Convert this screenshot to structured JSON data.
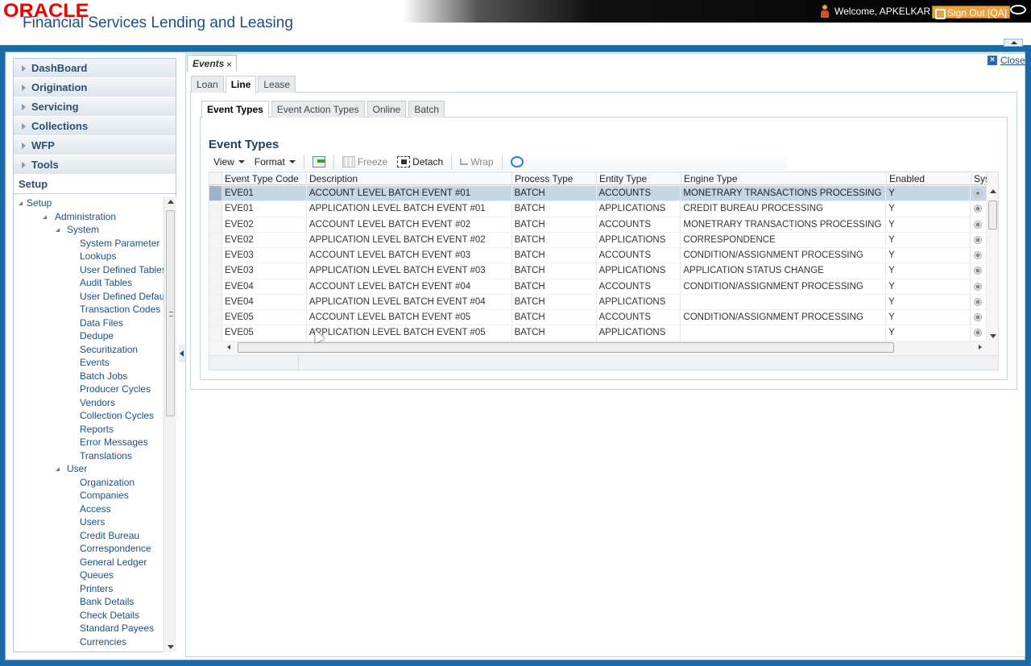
{
  "header": {
    "logo": "ORACLE",
    "product": "Financial Services Lending and Leasing",
    "welcome": "Welcome, APKELKAR",
    "sign_out": "Sign Out [QA]"
  },
  "nav": {
    "sections": [
      "DashBoard",
      "Origination",
      "Servicing",
      "Collections",
      "WFP",
      "Tools"
    ],
    "setup_label": "Setup",
    "tree": [
      {
        "label": "Setup",
        "level": 0,
        "expanded": true
      },
      {
        "label": "Administration",
        "level": 1,
        "expanded": true
      },
      {
        "label": "System",
        "level": 2,
        "expanded": true
      },
      {
        "label": "System Parameter",
        "level": 3
      },
      {
        "label": "Lookups",
        "level": 3
      },
      {
        "label": "User Defined Tables",
        "level": 3
      },
      {
        "label": "Audit Tables",
        "level": 3
      },
      {
        "label": "User Defined Defaults",
        "level": 3
      },
      {
        "label": "Transaction Codes",
        "level": 3
      },
      {
        "label": "Data Files",
        "level": 3
      },
      {
        "label": "Dedupe",
        "level": 3
      },
      {
        "label": "Securitization",
        "level": 3
      },
      {
        "label": "Events",
        "level": 3
      },
      {
        "label": "Batch Jobs",
        "level": 3
      },
      {
        "label": "Producer Cycles",
        "level": 3
      },
      {
        "label": "Vendors",
        "level": 3
      },
      {
        "label": "Collection Cycles",
        "level": 3
      },
      {
        "label": "Reports",
        "level": 3
      },
      {
        "label": "Error Messages",
        "level": 3
      },
      {
        "label": "Translations",
        "level": 3
      },
      {
        "label": "User",
        "level": 2,
        "expanded": true
      },
      {
        "label": "Organization",
        "level": 3
      },
      {
        "label": "Companies",
        "level": 3
      },
      {
        "label": "Access",
        "level": 3
      },
      {
        "label": "Users",
        "level": 3
      },
      {
        "label": "Credit Bureau",
        "level": 3
      },
      {
        "label": "Correspondence",
        "level": 3
      },
      {
        "label": "General Ledger",
        "level": 3
      },
      {
        "label": "Queues",
        "level": 3
      },
      {
        "label": "Printers",
        "level": 3
      },
      {
        "label": "Bank Details",
        "level": 3
      },
      {
        "label": "Check Details",
        "level": 3
      },
      {
        "label": "Standard Payees",
        "level": 3
      },
      {
        "label": "Currencies",
        "level": 3
      }
    ]
  },
  "main": {
    "doc_tab": "Events",
    "close_label": "Close",
    "tabs": [
      "Loan",
      "Line",
      "Lease"
    ],
    "active_tab": "Line",
    "sub_tabs": [
      "Event Types",
      "Event Action Types",
      "Online",
      "Batch"
    ],
    "active_sub_tab": "Event Types",
    "section_title": "Event Types",
    "toolbar": {
      "view": "View",
      "format": "Format",
      "freeze": "Freeze",
      "detach": "Detach",
      "wrap": "Wrap"
    },
    "columns": [
      "Event Type Code",
      "Description",
      "Process Type",
      "Entity Type",
      "Engine Type",
      "Enabled",
      "Sys"
    ],
    "rows": [
      [
        "EVE01",
        "ACCOUNT LEVEL BATCH EVENT #01",
        "BATCH",
        "ACCOUNTS",
        "MONETRARY TRANSACTIONS PROCESSING",
        "Y"
      ],
      [
        "EVE01",
        "APPLICATION LEVEL BATCH EVENT #01",
        "BATCH",
        "APPLICATIONS",
        "CREDIT BUREAU PROCESSING",
        "Y"
      ],
      [
        "EVE02",
        "ACCOUNT LEVEL BATCH EVENT #02",
        "BATCH",
        "ACCOUNTS",
        "MONETRARY TRANSACTIONS PROCESSING",
        "Y"
      ],
      [
        "EVE02",
        "APPLICATION LEVEL BATCH EVENT #02",
        "BATCH",
        "APPLICATIONS",
        "CORRESPONDENCE",
        "Y"
      ],
      [
        "EVE03",
        "ACCOUNT LEVEL BATCH EVENT #03",
        "BATCH",
        "ACCOUNTS",
        "CONDITION/ASSIGNMENT PROCESSING",
        "Y"
      ],
      [
        "EVE03",
        "APPLICATION LEVEL BATCH EVENT #03",
        "BATCH",
        "APPLICATIONS",
        "APPLICATION STATUS CHANGE",
        "Y"
      ],
      [
        "EVE04",
        "ACCOUNT LEVEL BATCH EVENT #04",
        "BATCH",
        "ACCOUNTS",
        "CONDITION/ASSIGNMENT PROCESSING",
        "Y"
      ],
      [
        "EVE04",
        "APPLICATION LEVEL BATCH EVENT #04",
        "BATCH",
        "APPLICATIONS",
        "",
        "Y"
      ],
      [
        "EVE05",
        "ACCOUNT LEVEL BATCH EVENT #05",
        "BATCH",
        "ACCOUNTS",
        "CONDITION/ASSIGNMENT PROCESSING",
        "Y"
      ],
      [
        "EVE05",
        "APPLICATION LEVEL BATCH EVENT #05",
        "BATCH",
        "APPLICATIONS",
        "",
        "Y"
      ]
    ]
  },
  "colors": {
    "brand_red": "#e00000",
    "frame_blue": "#1a6aa8",
    "link_blue": "#1d4f82",
    "signout_orange": "#e9a23b"
  }
}
